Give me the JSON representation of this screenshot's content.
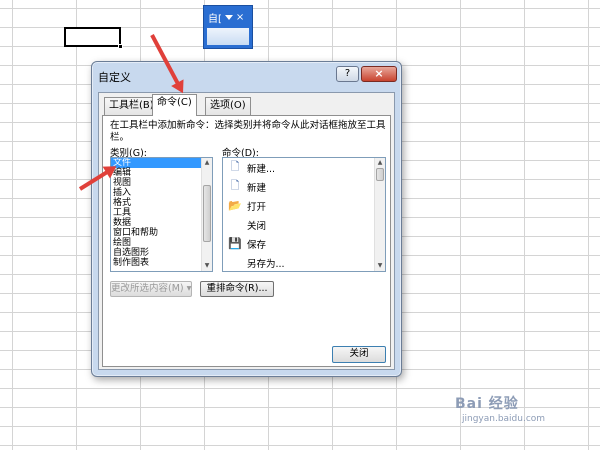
{
  "toolbar_popup": {
    "title": "自[",
    "close": "×"
  },
  "dialog": {
    "title": "自定义",
    "help": "?",
    "close_x": "×",
    "tabs": [
      {
        "label": "工具栏(B)"
      },
      {
        "label": "命令(C)"
      },
      {
        "label": "选项(O)"
      }
    ],
    "active_tab": "命令(C)",
    "description": "在工具栏中添加新命令：选择类别并将命令从此对话框拖放至工具栏。",
    "categories_label": "类别(G):",
    "commands_label": "命令(D):",
    "categories": [
      "文件",
      "编辑",
      "视图",
      "插入",
      "格式",
      "工具",
      "数据",
      "窗口和帮助",
      "绘图",
      "自选图形",
      "制作图表"
    ],
    "selected_category": "文件",
    "commands": [
      {
        "label": "新建...",
        "icon": "new-document-icon"
      },
      {
        "label": "新建",
        "icon": "new-document-icon"
      },
      {
        "label": "打开",
        "icon": "open-folder-icon"
      },
      {
        "label": "关闭",
        "icon": "none"
      },
      {
        "label": "保存",
        "icon": "save-disk-icon"
      },
      {
        "label": "另存为...",
        "icon": "none"
      }
    ],
    "modify_selection_button": "更改所选内容(M) ▾",
    "rearrange_button": "重排命令(R)...",
    "close_button": "关闭"
  },
  "watermark": {
    "main": "Bai 经验",
    "sub": "jingyan.baidu.com"
  },
  "colors": {
    "annotation_arrow": "#e0403a",
    "selection": "#3399ff",
    "toolbar_blue": "#2a6ed2"
  }
}
